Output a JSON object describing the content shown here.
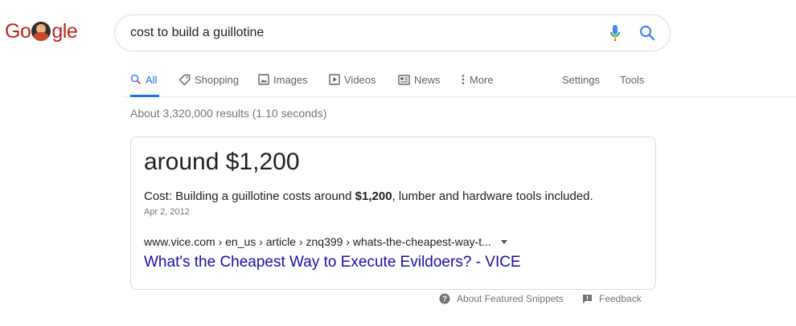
{
  "logo": {
    "part1": "Go",
    "part2": "gle"
  },
  "search": {
    "query": "cost to build a guillotine"
  },
  "tabs": [
    {
      "label": "All"
    },
    {
      "label": "Shopping"
    },
    {
      "label": "Images"
    },
    {
      "label": "Videos"
    },
    {
      "label": "News"
    },
    {
      "label": "More"
    },
    {
      "label": "Settings"
    },
    {
      "label": "Tools"
    }
  ],
  "result_stats": "About 3,320,000 results (1.10 seconds)",
  "snippet": {
    "answer": "around $1,200",
    "text_before": "Cost: Building a guillotine costs around ",
    "text_bold": "$1,200",
    "text_after": ", lumber and hardware tools included.",
    "date": "Apr 2, 2012",
    "cite": "www.vice.com › en_us › article › znq399 › whats-the-cheapest-way-t...",
    "title": "What's the Cheapest Way to Execute Evildoers? - VICE"
  },
  "footer": {
    "about": "About Featured Snippets",
    "feedback": "Feedback"
  },
  "colors": {
    "link": "#1a0dab",
    "accent": "#1a73e8"
  }
}
